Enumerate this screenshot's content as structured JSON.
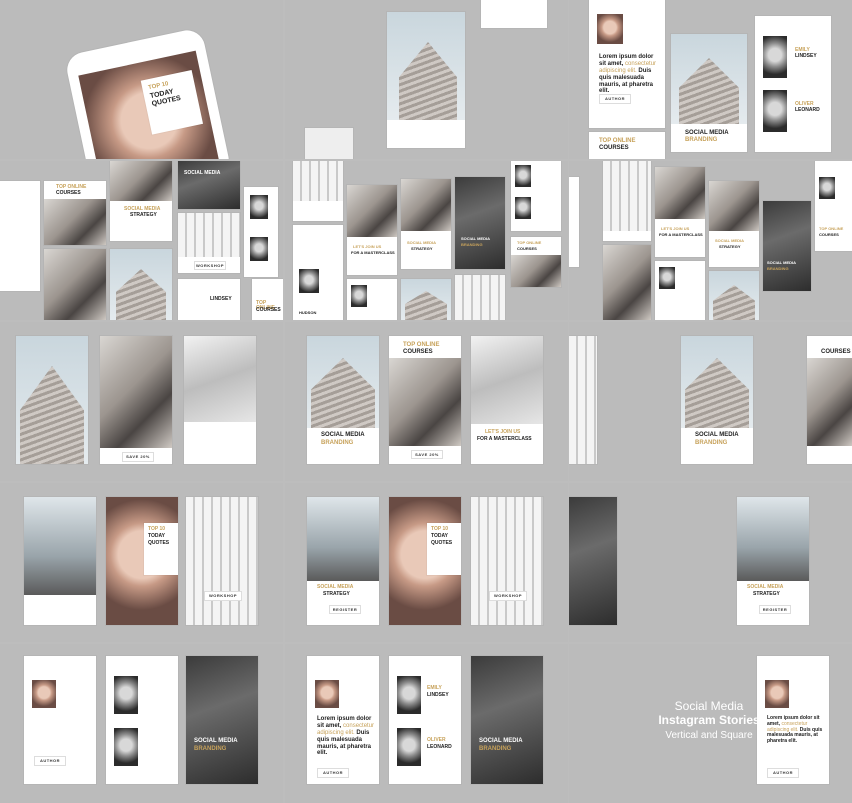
{
  "colors": {
    "background": "#bbbbbb",
    "accent_gold": "#c7a25b",
    "dark_text": "#222222"
  },
  "texts": {
    "today_quotes_top": "TOP 10",
    "today_quotes_1": "TODAY",
    "today_quotes_2": "QUOTES",
    "lorem_1": "Lorem ipsum dolor",
    "lorem_2": "sit amet,",
    "lorem_gold": "consectetur adipiscing elit.",
    "lorem_3": "Duis quis malesuada",
    "lorem_4": "mauris, at pharetra elit.",
    "author_btn": "AUTHOR",
    "emily_1": "EMILY",
    "emily_2": "LINDSEY",
    "oliver_1": "OLIVER",
    "oliver_2": "LEONARD",
    "sm_branding_1": "SOCIAL MEDIA",
    "sm_branding_2": "BRANDING",
    "sm_strategy_1": "SOCIAL MEDIA",
    "sm_strategy_2": "STRATEGY",
    "top_online_1": "TOP ONLINE",
    "top_online_2": "COURSES",
    "join_1": "LET'S JOIN US",
    "join_2": "FOR A MASTERCLASS",
    "save_btn": "SAVE 20%",
    "workshop_btn": "WORKSHOP",
    "register_btn": "REGISTER",
    "hudson": "HUDSON",
    "promo_line1": "Social Media",
    "promo_line2": "Instagram Stories",
    "promo_line3": "Vertical and Square"
  }
}
